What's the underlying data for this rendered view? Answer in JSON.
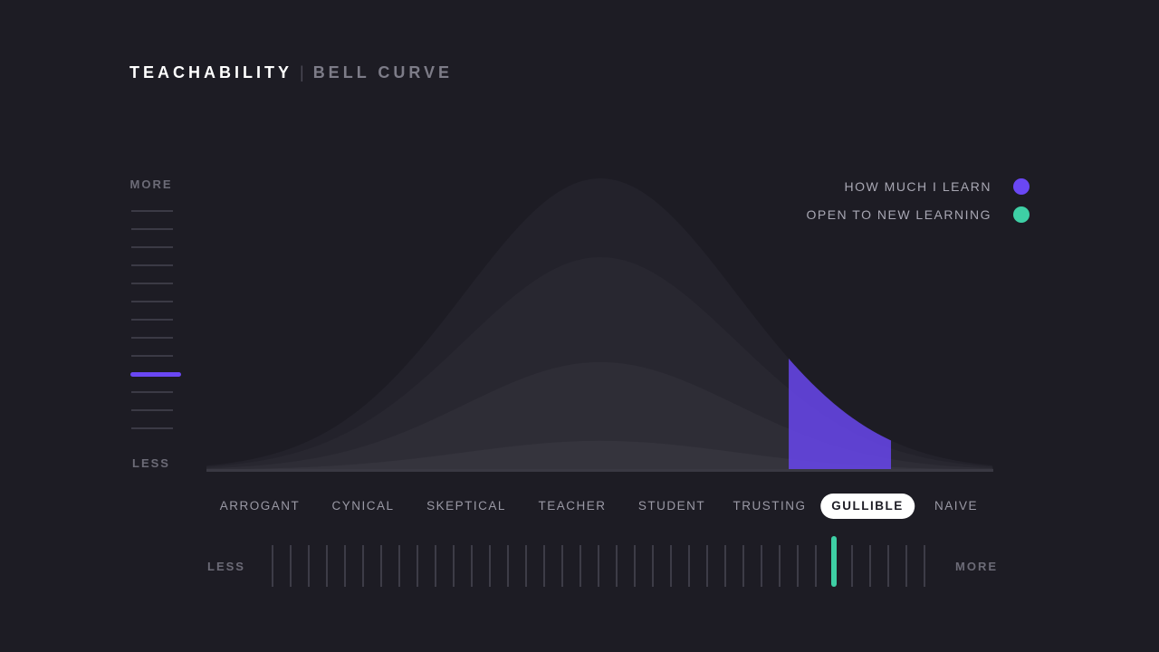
{
  "header": {
    "title": "TEACHABILITY",
    "separator": "|",
    "subtitle": "BELL CURVE"
  },
  "vertical_scale": {
    "top_label": "MORE",
    "bottom_label": "LESS",
    "tick_count": 13,
    "active_index": 9,
    "color": "#6a47f4"
  },
  "horizontal_scale": {
    "left_label": "LESS",
    "right_label": "MORE",
    "tick_count": 37,
    "active_index": 31,
    "color": "#3ecfa5"
  },
  "legend": [
    {
      "label": "HOW MUCH I LEARN",
      "color": "#6a47f4"
    },
    {
      "label": "OPEN TO NEW LEARNING",
      "color": "#3ecfa5"
    }
  ],
  "chart_data": {
    "type": "area",
    "title": "TEACHABILITY | BELL CURVE",
    "categories": [
      "ARROGANT",
      "CYNICAL",
      "SKEPTICAL",
      "TEACHER",
      "STUDENT",
      "TRUSTING",
      "GULLIBLE",
      "NAIVE"
    ],
    "selected_category": "GULLIBLE",
    "curve_layers": [
      {
        "level": 1.0
      },
      {
        "level": 0.73
      },
      {
        "level": 0.37
      },
      {
        "level": 0.1
      }
    ],
    "highlight": {
      "from": 0.74,
      "to": 0.87,
      "color": "#6a47f4"
    },
    "y_axis_labels": [
      "MORE",
      "LESS"
    ],
    "x_axis_labels": [
      "LESS",
      "MORE"
    ],
    "grid": false,
    "legend_position": "top-right"
  }
}
